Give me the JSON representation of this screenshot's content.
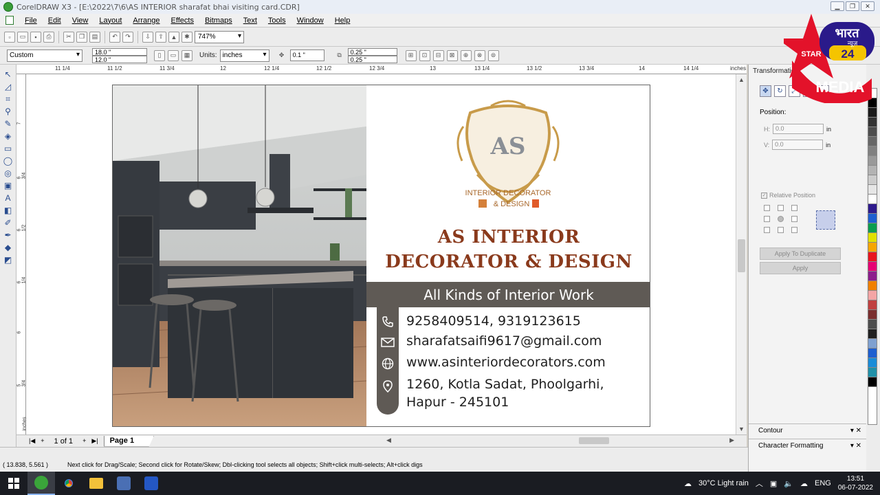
{
  "window": {
    "title": "CorelDRAW X3 - [E:\\2022\\7\\6\\AS INTERIOR sharafat bhai visiting card.CDR]"
  },
  "menu": [
    "File",
    "Edit",
    "View",
    "Layout",
    "Arrange",
    "Effects",
    "Bitmaps",
    "Text",
    "Tools",
    "Window",
    "Help"
  ],
  "toolbar": {
    "zoom": "747%",
    "paper_type": "Custom",
    "width": "18.0 \"",
    "height": "12.0 \"",
    "units_label": "Units:",
    "units_value": "inches",
    "nudge": "0.1 \"",
    "dup_x": "0.25 \"",
    "dup_y": "0.25 \""
  },
  "ruler": {
    "labels": [
      "11 1/4",
      "11 1/2",
      "11 3/4",
      "12",
      "12 1/4",
      "12 1/2",
      "12 3/4",
      "13",
      "13 1/4",
      "13 1/2",
      "13 3/4",
      "14",
      "14 1/4",
      "inches"
    ],
    "vlabels": [
      "7",
      "6 3/4",
      "6 1/2",
      "6 1/4",
      "6",
      "5 3/4",
      "inches"
    ]
  },
  "card": {
    "logo_initials": "AS",
    "logo_line1": "INTERIOR DECORATOR",
    "logo_line2": "& DESIGN",
    "company_line1": "AS INTERIOR",
    "company_line2": "DECORATOR & DESIGN",
    "tagline": "All Kinds of Interior Work",
    "phone": "9258409514, 9319123615",
    "email": "sharafatsaifi9617@gmail.com",
    "website": "www.asinteriordecorators.com",
    "address_line1": "1260, Kotla Sadat, Phoolgarhi,",
    "address_line2": "Hapur - 245101",
    "accent_color": "#8a3a1c",
    "band_color": "#5f5a55"
  },
  "pages": {
    "count": "1 of 1",
    "tab": "Page 1"
  },
  "status": {
    "coords": "( 13.838, 5.561 )",
    "hint": "Next click for Drag/Scale; Second click for Rotate/Skew; Dbl-clicking tool selects all objects; Shift+click multi-selects; Alt+click digs"
  },
  "docker": {
    "title": "Transformation",
    "position_label": "Position:",
    "h_label": "H:",
    "h_value": "0.0",
    "v_label": "V:",
    "v_value": "0.0",
    "unit": "in",
    "relative_position": "Relative Position",
    "apply_duplicate": "Apply To Duplicate",
    "apply": "Apply",
    "contour": "Contour",
    "char_format": "Character Formatting"
  },
  "watermark": {
    "star_text": "STAR",
    "brand": "भारत",
    "brand_sub": "न्यूज़",
    "number": "24",
    "media": "MEDIA"
  },
  "taskbar": {
    "weather": "30°C  Light rain",
    "lang": "ENG",
    "time": "13:51",
    "date": "06-07-2022"
  },
  "palette_colors": [
    "#ffffff",
    "#000000",
    "#1a1a1a",
    "#333333",
    "#4d4d4d",
    "#666666",
    "#808080",
    "#999999",
    "#b3b3b3",
    "#cccccc",
    "#e6e6e6",
    "#ffffff",
    "#2e1a8c",
    "#1e5fd0",
    "#0a9d4e",
    "#e0e000",
    "#f6a600",
    "#e8141e",
    "#e60073",
    "#8c1e8c",
    "#f08000",
    "#f4a5a5",
    "#c04040",
    "#7a2e2e",
    "#4d4d4d",
    "#202020",
    "#7fa0d0",
    "#1e5fd0",
    "#1a8cd8",
    "#2090a8",
    "#000000"
  ]
}
